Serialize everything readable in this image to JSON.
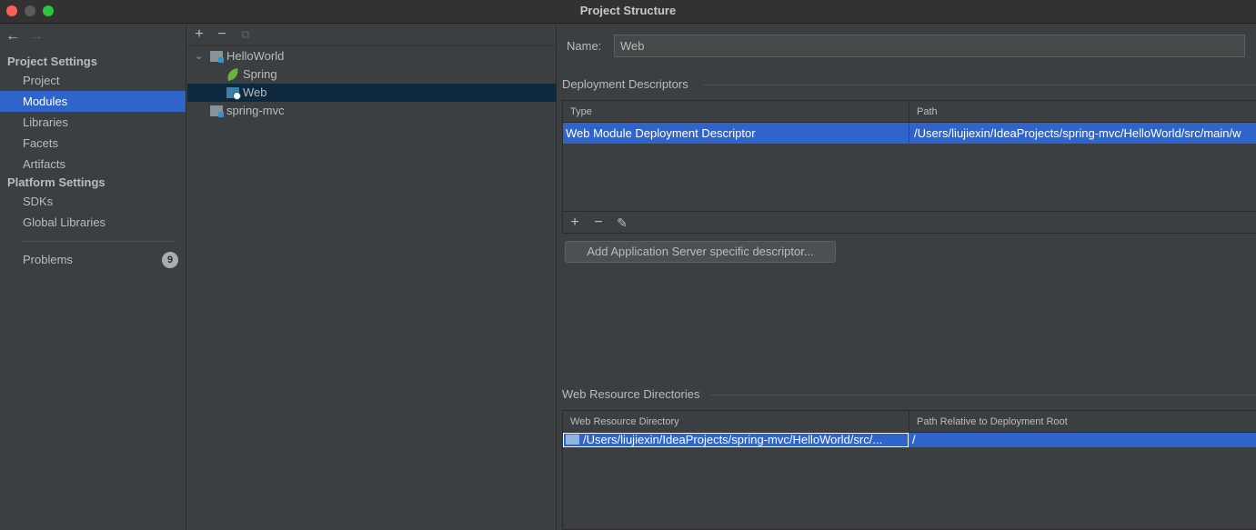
{
  "window": {
    "title": "Project Structure"
  },
  "nav": {
    "project_settings_header": "Project Settings",
    "project_settings_items": [
      {
        "label": "Project",
        "selected": false
      },
      {
        "label": "Modules",
        "selected": true
      },
      {
        "label": "Libraries",
        "selected": false
      },
      {
        "label": "Facets",
        "selected": false
      },
      {
        "label": "Artifacts",
        "selected": false
      }
    ],
    "platform_settings_header": "Platform Settings",
    "platform_settings_items": [
      {
        "label": "SDKs"
      },
      {
        "label": "Global Libraries"
      }
    ],
    "problems": {
      "label": "Problems",
      "count": "9"
    }
  },
  "tree": {
    "nodes": [
      {
        "label": "HelloWorld",
        "icon": "module-folder-icon",
        "expanded": true
      },
      {
        "label": "Spring",
        "icon": "spring-leaf-icon"
      },
      {
        "label": "Web",
        "icon": "web-facet-icon",
        "selected": true
      },
      {
        "label": "spring-mvc",
        "icon": "module-folder-icon"
      }
    ]
  },
  "details": {
    "name_label": "Name:",
    "name_value": "Web",
    "deployment_descriptors": {
      "title": "Deployment Descriptors",
      "columns": [
        "Type",
        "Path"
      ],
      "rows": [
        {
          "type": "Web Module Deployment Descriptor",
          "path": "/Users/liujiexin/IdeaProjects/spring-mvc/HelloWorld/src/main/w"
        }
      ]
    },
    "add_server_descriptor_label": "Add Application Server specific descriptor...",
    "web_resource_directories": {
      "title": "Web Resource Directories",
      "columns": [
        "Web Resource Directory",
        "Path Relative to Deployment Root"
      ],
      "rows": [
        {
          "directory": "/Users/liujiexin/IdeaProjects/spring-mvc/HelloWorld/src/...",
          "relative": "/"
        }
      ]
    }
  },
  "colors": {
    "selection": "#2f65ca",
    "tree_selection": "#0d293e",
    "background": "#3c3f41",
    "text": "#bbbbbb"
  }
}
